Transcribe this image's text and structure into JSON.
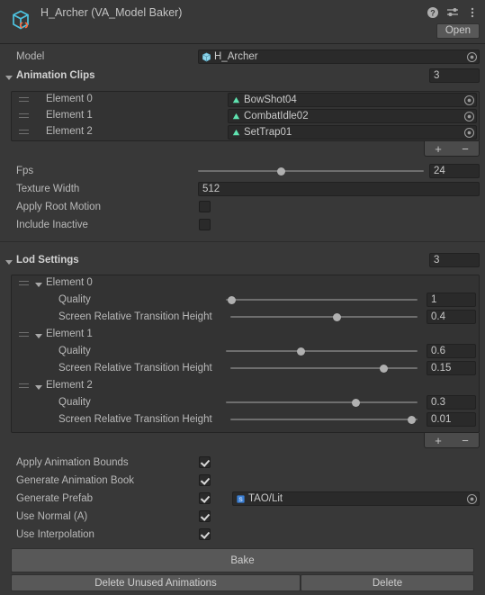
{
  "header": {
    "title": "H_Archer (VA_Model Baker)",
    "component_icon": "script-cube-icon",
    "help_icon": "help-icon",
    "preset_icon": "preset-sliders-icon",
    "menu_icon": "kebab-menu-icon",
    "open_label": "Open"
  },
  "model": {
    "label": "Model",
    "value": "H_Archer",
    "icon": "prefab-model-icon"
  },
  "animation_clips": {
    "label": "Animation Clips",
    "count": "3",
    "elements": [
      {
        "name": "Element 0",
        "clip": "BowShot04"
      },
      {
        "name": "Element 1",
        "clip": "CombatIdle02"
      },
      {
        "name": "Element 2",
        "clip": "SetTrap01"
      }
    ],
    "add_label": "+",
    "remove_label": "−"
  },
  "settings": {
    "fps": {
      "label": "Fps",
      "value": "24",
      "fraction": 0.37
    },
    "texture_width": {
      "label": "Texture Width",
      "value": "512"
    },
    "apply_root_motion": {
      "label": "Apply Root Motion",
      "checked": false
    },
    "include_inactive": {
      "label": "Include Inactive",
      "checked": false
    }
  },
  "lod_settings": {
    "label": "Lod Settings",
    "count": "3",
    "quality_label": "Quality",
    "transition_label": "Screen Relative Transition Height",
    "elements": [
      {
        "name": "Element 0",
        "quality": "1",
        "quality_fraction": 0.03,
        "transition": "0.4",
        "transition_fraction": 0.57
      },
      {
        "name": "Element 1",
        "quality": "0.6",
        "quality_fraction": 0.39,
        "transition": "0.15",
        "transition_fraction": 0.82
      },
      {
        "name": "Element 2",
        "quality": "0.3",
        "quality_fraction": 0.68,
        "transition": "0.01",
        "transition_fraction": 0.97
      }
    ],
    "add_label": "+",
    "remove_label": "−"
  },
  "options": {
    "apply_animation_bounds": {
      "label": "Apply Animation Bounds",
      "checked": true
    },
    "generate_animation_book": {
      "label": "Generate Animation Book",
      "checked": true
    },
    "generate_prefab": {
      "label": "Generate Prefab",
      "checked": true,
      "shader": "TAO/Lit",
      "shader_icon": "shader-icon"
    },
    "use_normal": {
      "label": "Use Normal (A)",
      "checked": true
    },
    "use_interpolation": {
      "label": "Use Interpolation",
      "checked": true
    }
  },
  "actions": {
    "bake": "Bake",
    "delete_unused": "Delete Unused Animations",
    "delete": "Delete"
  },
  "colors": {
    "background": "#383838",
    "field": "#2a2a2a",
    "button": "#585858",
    "accent_cyan": "#4ec3e0",
    "accent_orange": "#ff6a3d",
    "clip_green": "#5fe3b0",
    "shader_blue": "#3b7fd4"
  }
}
